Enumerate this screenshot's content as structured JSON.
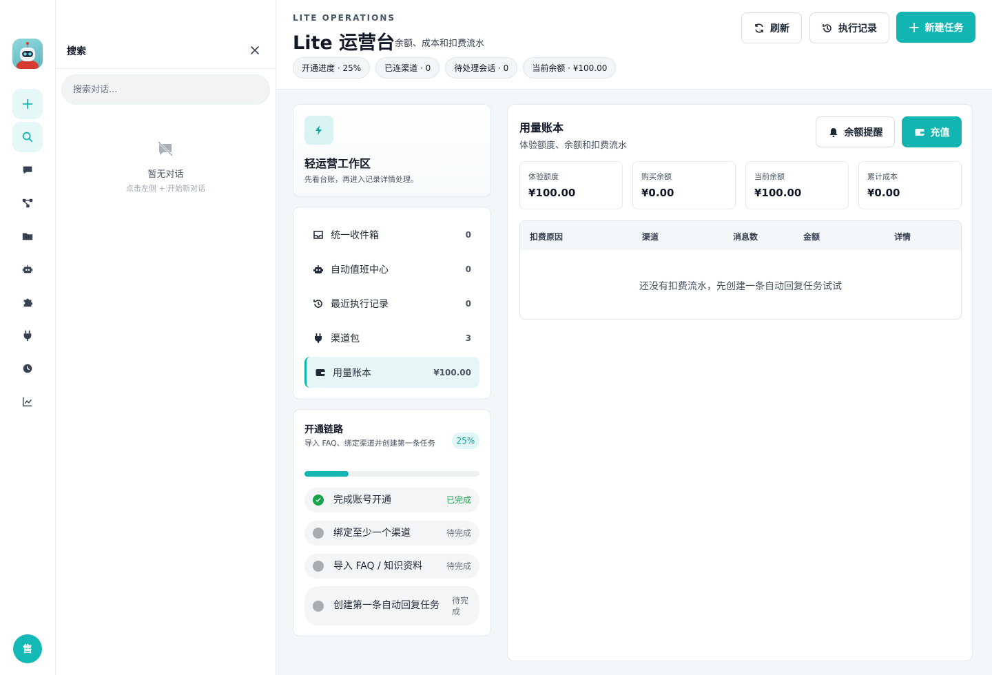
{
  "rail": {
    "items": [
      "add",
      "search",
      "chat",
      "flow",
      "folder",
      "robot",
      "plugin",
      "plug",
      "clock",
      "chart"
    ],
    "user_avatar_text": "售"
  },
  "search_panel": {
    "title": "搜索",
    "placeholder": "搜索对话...",
    "empty_title": "暂无对话",
    "empty_hint": "点击左侧 + 开始新对话"
  },
  "header": {
    "eyebrow": "LITE OPERATIONS",
    "title": "Lite 运营台",
    "subtitle": "余额、成本和扣费流水",
    "chips": [
      "开通进度 · 25%",
      "已连渠道 · 0",
      "待处理会话 · 0",
      "当前余额 · ¥100.00"
    ],
    "buttons": {
      "refresh": "刷新",
      "history": "执行记录",
      "new_task": "新建任务"
    }
  },
  "workspace": {
    "title": "轻运营工作区",
    "desc": "先看台账，再进入记录详情处理。"
  },
  "nav": [
    {
      "label": "统一收件箱",
      "count": "0"
    },
    {
      "label": "自动值班中心",
      "count": "0"
    },
    {
      "label": "最近执行记录",
      "count": "0"
    },
    {
      "label": "渠道包",
      "count": "3"
    },
    {
      "label": "用量账本",
      "count": "¥100.00"
    }
  ],
  "flow": {
    "title": "开通链路",
    "desc": "导入 FAQ、绑定渠道并创建第一条任务",
    "percent_label": "25%",
    "progress": 0.25,
    "steps": [
      {
        "label": "完成账号开通",
        "state": "已完成"
      },
      {
        "label": "绑定至少一个渠道",
        "state": "待完成"
      },
      {
        "label": "导入 FAQ / 知识资料",
        "state": "待完成"
      },
      {
        "label": "创建第一条自动回复任务",
        "state": "待完成"
      }
    ]
  },
  "ledger": {
    "title": "用量账本",
    "subtitle": "体验额度、余额和扣费流水",
    "alert_button": "余额提醒",
    "recharge_button": "充值",
    "stats": [
      {
        "label": "体验额度",
        "value": "¥100.00"
      },
      {
        "label": "购买余额",
        "value": "¥0.00"
      },
      {
        "label": "当前余额",
        "value": "¥100.00"
      },
      {
        "label": "累计成本",
        "value": "¥0.00"
      }
    ],
    "columns": [
      "扣费原因",
      "渠道",
      "消息数",
      "金额",
      "详情"
    ],
    "empty_text": "还没有扣费流水，先创建一条自动回复任务试试"
  }
}
